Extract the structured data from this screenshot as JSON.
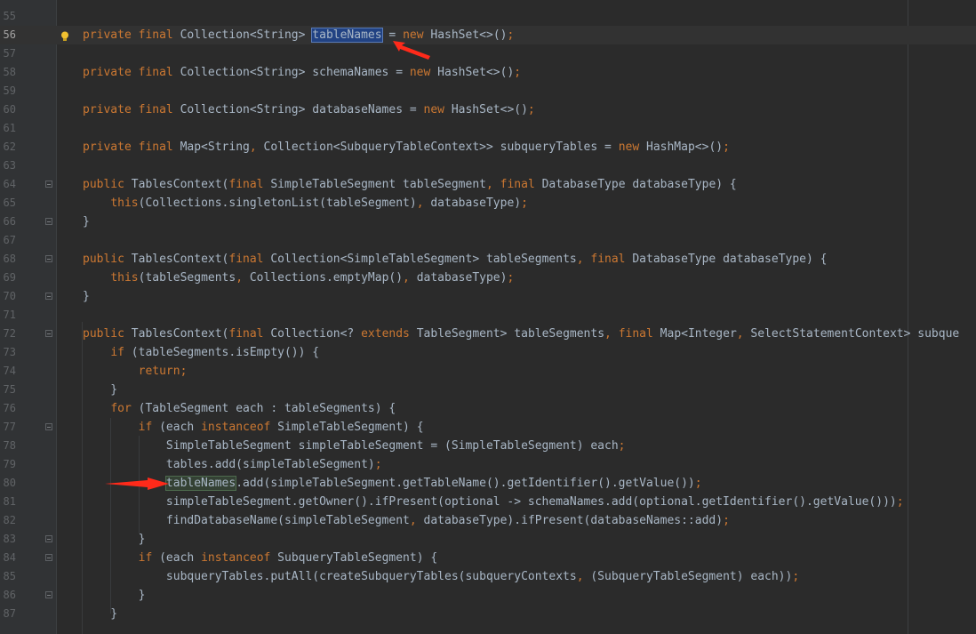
{
  "editor": {
    "lines": [
      {
        "num": "55",
        "segments": []
      },
      {
        "num": "56",
        "segments": [
          {
            "t": "private final ",
            "c": "k"
          },
          {
            "t": "Collection<String> "
          },
          {
            "t": "tableNames",
            "c": "sel"
          },
          {
            "t": " = "
          },
          {
            "t": "new ",
            "c": "k"
          },
          {
            "t": "HashSet<>()"
          },
          {
            "t": ";",
            "c": "k"
          }
        ]
      },
      {
        "num": "57",
        "segments": []
      },
      {
        "num": "58",
        "segments": [
          {
            "t": "private final ",
            "c": "k"
          },
          {
            "t": "Collection<String> schemaNames = "
          },
          {
            "t": "new ",
            "c": "k"
          },
          {
            "t": "HashSet<>()"
          },
          {
            "t": ";",
            "c": "k"
          }
        ]
      },
      {
        "num": "59",
        "segments": []
      },
      {
        "num": "60",
        "segments": [
          {
            "t": "private final ",
            "c": "k"
          },
          {
            "t": "Collection<String> databaseNames = "
          },
          {
            "t": "new ",
            "c": "k"
          },
          {
            "t": "HashSet<>()"
          },
          {
            "t": ";",
            "c": "k"
          }
        ]
      },
      {
        "num": "61",
        "segments": []
      },
      {
        "num": "62",
        "segments": [
          {
            "t": "private final ",
            "c": "k"
          },
          {
            "t": "Map<String"
          },
          {
            "t": ", ",
            "c": "k"
          },
          {
            "t": "Collection<SubqueryTableContext>> subqueryTables = "
          },
          {
            "t": "new ",
            "c": "k"
          },
          {
            "t": "HashMap<>()"
          },
          {
            "t": ";",
            "c": "k"
          }
        ]
      },
      {
        "num": "63",
        "segments": []
      },
      {
        "num": "64",
        "segments": [
          {
            "t": "public ",
            "c": "k"
          },
          {
            "t": "TablesContext("
          },
          {
            "t": "final ",
            "c": "k"
          },
          {
            "t": "SimpleTableSegment tableSegment"
          },
          {
            "t": ", ",
            "c": "k"
          },
          {
            "t": "final ",
            "c": "k"
          },
          {
            "t": "DatabaseType databaseType) {"
          }
        ]
      },
      {
        "num": "65",
        "segments": [
          {
            "t": "    "
          },
          {
            "t": "this",
            "c": "k"
          },
          {
            "t": "(Collections.singletonList(tableSegment)"
          },
          {
            "t": ", ",
            "c": "k"
          },
          {
            "t": "databaseType)"
          },
          {
            "t": ";",
            "c": "k"
          }
        ]
      },
      {
        "num": "66",
        "segments": [
          {
            "t": "}"
          }
        ]
      },
      {
        "num": "67",
        "segments": []
      },
      {
        "num": "68",
        "segments": [
          {
            "t": "public ",
            "c": "k"
          },
          {
            "t": "TablesContext("
          },
          {
            "t": "final ",
            "c": "k"
          },
          {
            "t": "Collection<SimpleTableSegment> tableSegments"
          },
          {
            "t": ", ",
            "c": "k"
          },
          {
            "t": "final ",
            "c": "k"
          },
          {
            "t": "DatabaseType databaseType) {"
          }
        ]
      },
      {
        "num": "69",
        "segments": [
          {
            "t": "    "
          },
          {
            "t": "this",
            "c": "k"
          },
          {
            "t": "(tableSegments"
          },
          {
            "t": ", ",
            "c": "k"
          },
          {
            "t": "Collections.emptyMap()"
          },
          {
            "t": ", ",
            "c": "k"
          },
          {
            "t": "databaseType)"
          },
          {
            "t": ";",
            "c": "k"
          }
        ]
      },
      {
        "num": "70",
        "segments": [
          {
            "t": "}"
          }
        ]
      },
      {
        "num": "71",
        "segments": []
      },
      {
        "num": "72",
        "segments": [
          {
            "t": "public ",
            "c": "k"
          },
          {
            "t": "TablesContext("
          },
          {
            "t": "final ",
            "c": "k"
          },
          {
            "t": "Collection<? "
          },
          {
            "t": "extends ",
            "c": "k"
          },
          {
            "t": "TableSegment> tableSegments"
          },
          {
            "t": ", ",
            "c": "k"
          },
          {
            "t": "final ",
            "c": "k"
          },
          {
            "t": "Map<Integer"
          },
          {
            "t": ", ",
            "c": "k"
          },
          {
            "t": "SelectStatementContext> subque"
          }
        ]
      },
      {
        "num": "73",
        "segments": [
          {
            "t": "    "
          },
          {
            "t": "if ",
            "c": "k"
          },
          {
            "t": "(tableSegments.isEmpty()) {"
          }
        ]
      },
      {
        "num": "74",
        "segments": [
          {
            "t": "        "
          },
          {
            "t": "return;",
            "c": "k"
          }
        ]
      },
      {
        "num": "75",
        "segments": [
          {
            "t": "    }"
          }
        ]
      },
      {
        "num": "76",
        "segments": [
          {
            "t": "    "
          },
          {
            "t": "for ",
            "c": "k"
          },
          {
            "t": "(TableSegment each : tableSegments) {"
          }
        ]
      },
      {
        "num": "77",
        "segments": [
          {
            "t": "        "
          },
          {
            "t": "if ",
            "c": "k"
          },
          {
            "t": "(each "
          },
          {
            "t": "instanceof ",
            "c": "k"
          },
          {
            "t": "SimpleTableSegment) {"
          }
        ]
      },
      {
        "num": "78",
        "segments": [
          {
            "t": "            SimpleTableSegment simpleTableSegment = (SimpleTableSegment) each"
          },
          {
            "t": ";",
            "c": "k"
          }
        ]
      },
      {
        "num": "79",
        "segments": [
          {
            "t": "            tables.add(simpleTableSegment)"
          },
          {
            "t": ";",
            "c": "k"
          }
        ]
      },
      {
        "num": "80",
        "segments": [
          {
            "t": "            "
          },
          {
            "t": "tableNames",
            "c": "hl"
          },
          {
            "t": ".add(simpleTableSegment.getTableName().getIdentifier().getValue())"
          },
          {
            "t": ";",
            "c": "k"
          }
        ]
      },
      {
        "num": "81",
        "segments": [
          {
            "t": "            simpleTableSegment.getOwner().ifPresent(optional -> schemaNames.add(optional.getIdentifier().getValue()))"
          },
          {
            "t": ";",
            "c": "k"
          }
        ]
      },
      {
        "num": "82",
        "segments": [
          {
            "t": "            findDatabaseName(simpleTableSegment"
          },
          {
            "t": ", ",
            "c": "k"
          },
          {
            "t": "databaseType).ifPresent(databaseNames::add)"
          },
          {
            "t": ";",
            "c": "k"
          }
        ]
      },
      {
        "num": "83",
        "segments": [
          {
            "t": "        }"
          }
        ]
      },
      {
        "num": "84",
        "segments": [
          {
            "t": "        "
          },
          {
            "t": "if ",
            "c": "k"
          },
          {
            "t": "(each "
          },
          {
            "t": "instanceof ",
            "c": "k"
          },
          {
            "t": "SubqueryTableSegment) {"
          }
        ]
      },
      {
        "num": "85",
        "segments": [
          {
            "t": "            subqueryTables.putAll(createSubqueryTables(subqueryContexts"
          },
          {
            "t": ", ",
            "c": "k"
          },
          {
            "t": "(SubqueryTableSegment) each))"
          },
          {
            "t": ";",
            "c": "k"
          }
        ]
      },
      {
        "num": "86",
        "segments": [
          {
            "t": "        }"
          }
        ]
      },
      {
        "num": "87",
        "segments": [
          {
            "t": "    }"
          }
        ]
      }
    ],
    "current_line": "56",
    "fold_lines": [
      "64",
      "66",
      "68",
      "70",
      "72",
      "77",
      "83",
      "84",
      "86"
    ],
    "colors": {
      "background": "#2b2b2b",
      "keyword": "#cc7832",
      "text": "#a9b7c6",
      "selection": "#214283",
      "highlight": "#344134",
      "arrow": "#ff2a1a"
    }
  },
  "annotations": {
    "arrow_1_target": "tableNames",
    "arrow_2_target": "tableNames"
  }
}
